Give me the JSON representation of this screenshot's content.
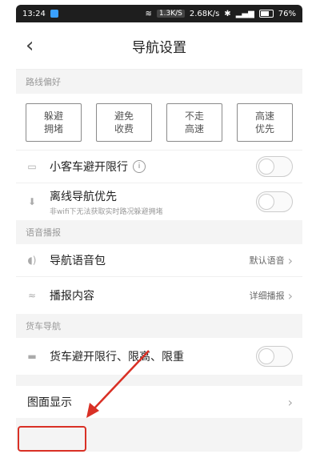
{
  "statusbar": {
    "time": "13:24",
    "speed1": "1.3K/S",
    "speed2": "2.68K/s",
    "battery": "76%"
  },
  "header": {
    "title": "导航设置"
  },
  "route_pref": {
    "section_title": "路线偏好",
    "options": [
      "躲避\n拥堵",
      "避免\n收费",
      "不走\n高速",
      "高速\n优先"
    ]
  },
  "settings1": {
    "car_limit": "小客车避开限行",
    "offline_title": "离线导航优先",
    "offline_sub": "非wifi下无法获取实时路况躲避拥堵"
  },
  "voice": {
    "section_title": "语音播报",
    "voice_pack": "导航语音包",
    "voice_pack_value": "默认语音",
    "broadcast": "播报内容",
    "broadcast_value": "详细播报"
  },
  "truck": {
    "section_title": "货车导航",
    "truck_limit": "货车避开限行、限高、限重"
  },
  "display": {
    "label": "图面显示"
  }
}
